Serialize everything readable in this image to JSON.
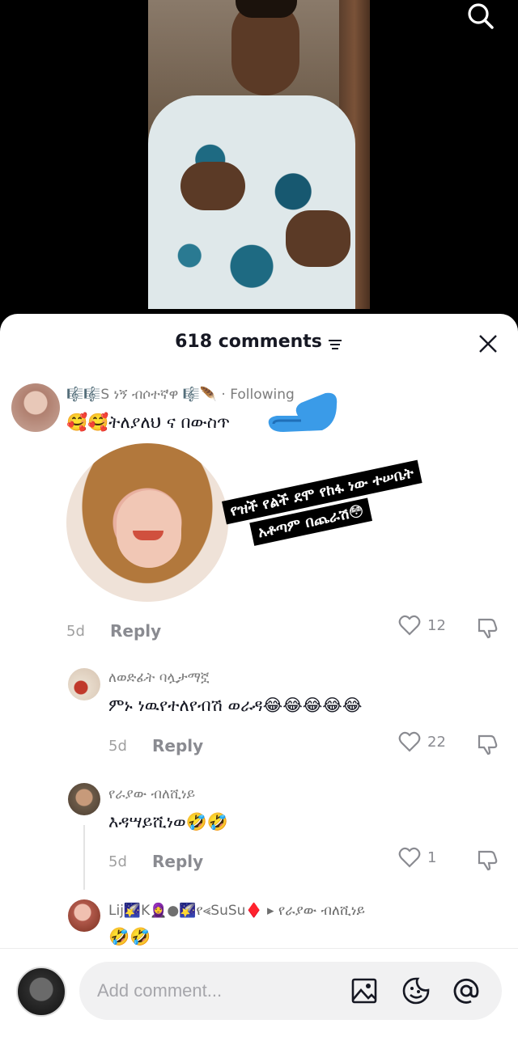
{
  "video": {
    "search_icon": "search-icon"
  },
  "sheet": {
    "comments_count": "618 comments",
    "filter_icon": "filter-icon",
    "close_icon": "close-icon"
  },
  "comments": [
    {
      "username": "🎼🎼S ነኝ ብሶተኛዋ 🎼🪶 · Following",
      "text": "🥰🥰ትለያለህ ና በውስጥ",
      "image_overlay": [
        "የዝች የልች ደሞ የከፋ ነው ተሠቤት",
        "አቶጣም በጨራሽ😳"
      ],
      "time": "5d",
      "reply_label": "Reply",
      "likes": "12"
    },
    {
      "username": "ለወድፊት   ባሏታማኟ",
      "text": "ምኑ ነዉየተለየብሽ ወራዳ😂😂😂😂😂",
      "time": "5d",
      "reply_label": "Reply",
      "likes": "22"
    },
    {
      "username": "የራያው ብለሺነይ",
      "text": "እዳሣይሺነወ🤣🤣",
      "time": "5d",
      "reply_label": "Reply",
      "likes": "1"
    },
    {
      "username": "Lij🌠K🧕●🌠የ⪡SuSu♦️ ▸ የራያው ብለሺነይ",
      "text": "🤣🤣"
    }
  ],
  "bottom": {
    "input_placeholder": "Add comment...",
    "image_icon": "image-icon",
    "emoji_icon": "emoji-icon",
    "mention_icon": "mention-icon"
  }
}
